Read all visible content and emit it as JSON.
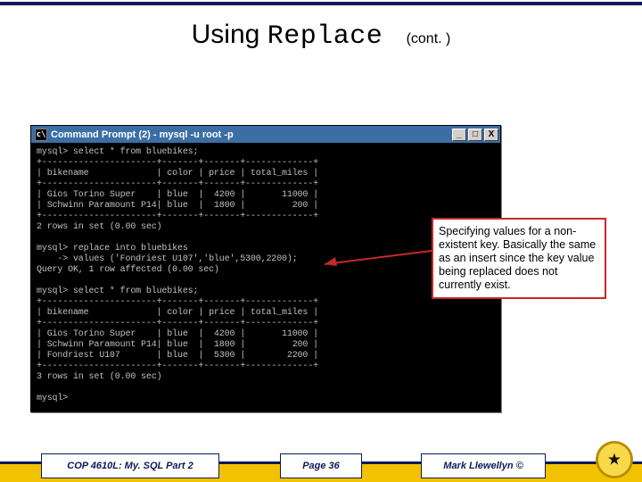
{
  "title": {
    "using": "Using",
    "replace": "Replace",
    "cont": "(cont. )"
  },
  "cmd": {
    "window_title": "Command Prompt (2) - mysql -u root -p",
    "btn_min": "_",
    "btn_max": "□",
    "btn_close": "X",
    "terminal_text": "mysql> select * from bluebikes;\n+----------------------+-------+-------+-------------+\n| bikename             | color | price | total_miles |\n+----------------------+-------+-------+-------------+\n| Gios Torino Super    | blue  |  4200 |       11000 |\n| Schwinn Paramount P14| blue  |  1800 |         200 |\n+----------------------+-------+-------+-------------+\n2 rows in set (0.00 sec)\n\nmysql> replace into bluebikes\n    -> values ('Fondriest U107','blue',5300,2200);\nQuery OK, 1 row affected (0.00 sec)\n\nmysql> select * from bluebikes;\n+----------------------+-------+-------+-------------+\n| bikename             | color | price | total_miles |\n+----------------------+-------+-------+-------------+\n| Gios Torino Super    | blue  |  4200 |       11000 |\n| Schwinn Paramount P14| blue  |  1800 |         200 |\n| Fondriest U107       | blue  |  5300 |        2200 |\n+----------------------+-------+-------+-------------+\n3 rows in set (0.00 sec)\n\nmysql>"
  },
  "callout": {
    "text": "Specifying values for a non-existent key. Basically the same as an insert since the key value being replaced does not currently exist."
  },
  "footer": {
    "left": "COP 4610L: My. SQL Part 2",
    "mid": "Page 36",
    "right": "Mark Llewellyn ©"
  }
}
